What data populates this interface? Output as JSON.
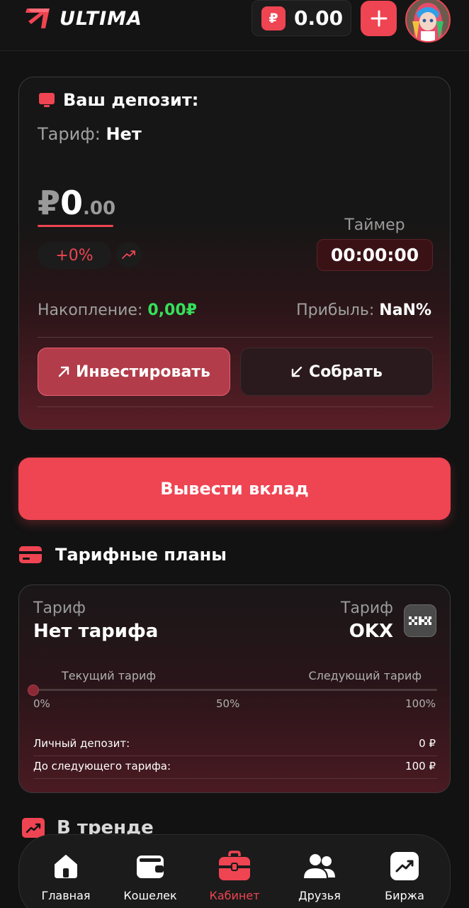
{
  "header": {
    "logo_text": "ULTIMA",
    "currency_symbol": "₽",
    "balance": "0.00",
    "add_label": "+"
  },
  "deposit": {
    "title": "Ваш депозит:",
    "tariff_key": "Тариф:",
    "tariff_value": "Нет",
    "amount_symbol": "₽",
    "amount_int": "0",
    "amount_dec": ".00",
    "change_pct": "+0%",
    "timer_label": "Таймер",
    "timer_value": "00:00:00",
    "accum_key": "Накопление:",
    "accum_value": "0,00₽",
    "profit_key": "Прибыль:",
    "profit_value": "NaN%",
    "invest_label": "Инвестировать",
    "collect_label": "Собрать"
  },
  "withdraw_label": "Вывести вклад",
  "plans": {
    "title": "Тарифные планы",
    "left_label": "Тариф",
    "left_value": "Нет тарифа",
    "right_label": "Тариф",
    "right_value": "OKX",
    "current_label": "Текущий тариф",
    "next_label": "Следующий тариф",
    "ticks": [
      "0%",
      "50%",
      "100%"
    ],
    "progress": 0,
    "personal_deposit_label": "Личный депозит:",
    "personal_deposit_value": "0 ₽",
    "to_next_label": "До следующего тарифа:",
    "to_next_value": "100 ₽"
  },
  "trend_title": "В тренде",
  "nav": [
    {
      "label": "Главная",
      "icon": "home-icon",
      "active": false
    },
    {
      "label": "Кошелек",
      "icon": "wallet-icon",
      "active": false
    },
    {
      "label": "Кабинет",
      "icon": "briefcase-icon",
      "active": true
    },
    {
      "label": "Друзья",
      "icon": "users-icon",
      "active": false
    },
    {
      "label": "Биржа",
      "icon": "chart-icon",
      "active": false
    }
  ],
  "colors": {
    "accent": "#ef4452",
    "positive": "#35e05a",
    "background": "#121212"
  }
}
